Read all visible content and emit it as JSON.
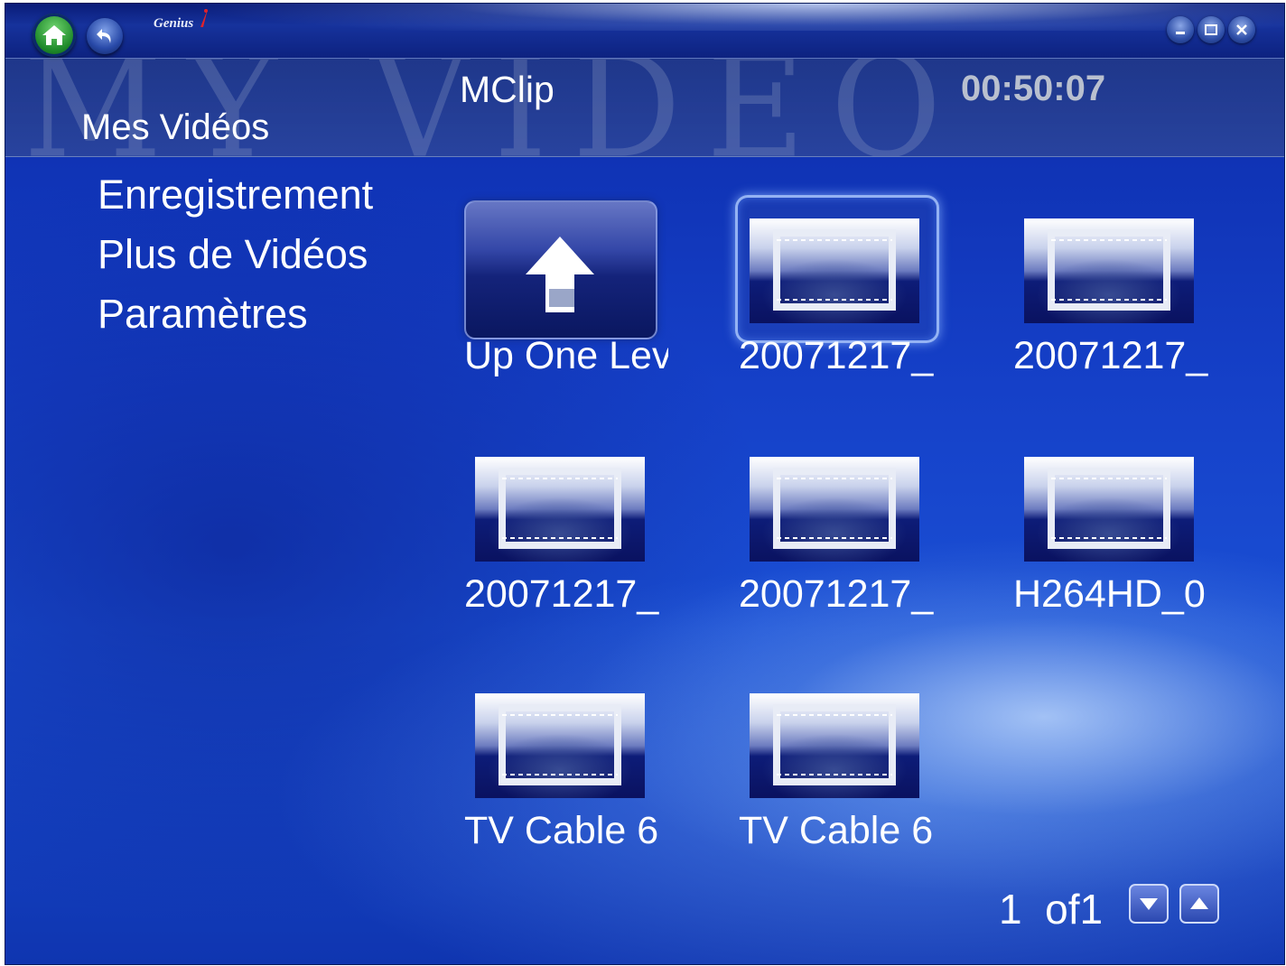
{
  "titlebar": {
    "logo_text": "Genius",
    "home_icon": "home-icon",
    "back_icon": "back-arrow-icon",
    "window_controls": [
      "minimize-icon",
      "maximize-icon",
      "close-icon"
    ]
  },
  "header": {
    "watermark": "MY VIDEO",
    "section_title": "Mes Vidéos",
    "app_title": "MClip",
    "clock": "00:50:07"
  },
  "menu": {
    "items": [
      {
        "label": "Enregistrement"
      },
      {
        "label": "Plus de Vidéos"
      },
      {
        "label": "Paramètres"
      }
    ]
  },
  "grid": {
    "items": [
      {
        "label": "Up One Lev",
        "icon": "up-arrow-icon"
      },
      {
        "label": "20071217_",
        "icon": "film-frame-icon",
        "selected": true
      },
      {
        "label": "20071217_",
        "icon": "film-frame-icon"
      },
      {
        "label": "20071217_",
        "icon": "film-frame-icon"
      },
      {
        "label": "20071217_",
        "icon": "film-frame-icon"
      },
      {
        "label": "H264HD_0",
        "icon": "film-frame-icon"
      },
      {
        "label": "TV Cable  6",
        "icon": "film-frame-icon"
      },
      {
        "label": "TV Cable  6",
        "icon": "film-frame-icon"
      }
    ]
  },
  "pager": {
    "text": "1  of1",
    "down_icon": "page-down-icon",
    "up_icon": "page-up-icon"
  },
  "colors": {
    "background": "#1a4fd4",
    "clock_text": "#b9c0cf",
    "home_button": "#1f8a2a"
  }
}
